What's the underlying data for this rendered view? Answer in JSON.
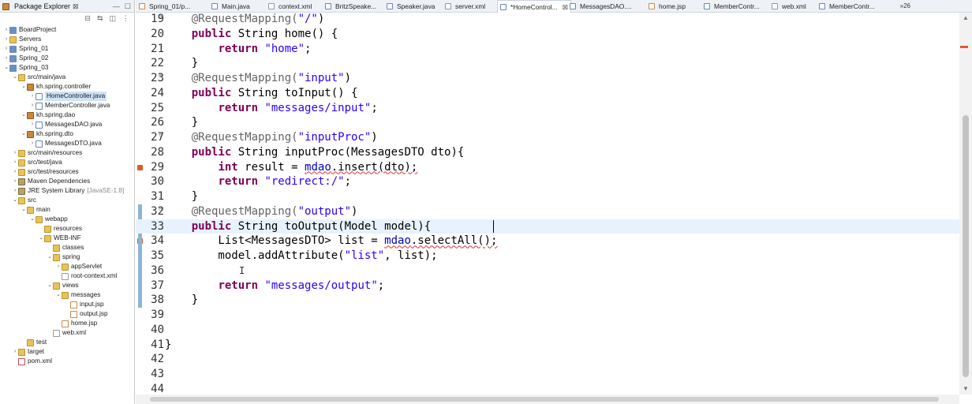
{
  "explorer": {
    "title": "Package Explorer",
    "close_glyph": "⊠",
    "tree": [
      {
        "label": "BoardProject",
        "arrow": "›",
        "icon": "project-icon",
        "indent": 0
      },
      {
        "label": "Servers",
        "arrow": "›",
        "icon": "folder-icon",
        "indent": 0
      },
      {
        "label": "Spring_01",
        "arrow": "›",
        "icon": "project-icon",
        "indent": 0
      },
      {
        "label": "Spring_02",
        "arrow": "›",
        "icon": "project-icon",
        "indent": 0
      },
      {
        "label": "Spring_03",
        "arrow": "⌄",
        "icon": "project-icon",
        "indent": 0
      },
      {
        "label": "src/main/java",
        "arrow": "⌄",
        "icon": "source-folder-icon",
        "indent": 1
      },
      {
        "label": "kh.spring.controller",
        "arrow": "⌄",
        "icon": "package-icon",
        "indent": 2
      },
      {
        "label": "HomeController.java",
        "arrow": "›",
        "icon": "java-file-icon",
        "indent": 3,
        "selected": true
      },
      {
        "label": "MemberController.java",
        "arrow": "›",
        "icon": "java-file-icon",
        "indent": 3
      },
      {
        "label": "kh.spring.dao",
        "arrow": "⌄",
        "icon": "package-icon",
        "indent": 2
      },
      {
        "label": "MessagesDAO.java",
        "arrow": "›",
        "icon": "java-file-icon",
        "indent": 3
      },
      {
        "label": "kh.spring.dto",
        "arrow": "⌄",
        "icon": "package-icon",
        "indent": 2
      },
      {
        "label": "MessagesDTO.java",
        "arrow": "›",
        "icon": "java-file-icon",
        "indent": 3
      },
      {
        "label": "src/main/resources",
        "arrow": "›",
        "icon": "source-folder-icon",
        "indent": 1
      },
      {
        "label": "src/test/java",
        "arrow": "›",
        "icon": "source-folder-icon",
        "indent": 1
      },
      {
        "label": "src/test/resources",
        "arrow": "›",
        "icon": "source-folder-icon",
        "indent": 1
      },
      {
        "label": "Maven Dependencies",
        "arrow": "›",
        "icon": "library-icon",
        "indent": 1
      },
      {
        "label": "JRE System Library",
        "extra": "[JavaSE-1.8]",
        "arrow": "›",
        "icon": "library-icon",
        "indent": 1
      },
      {
        "label": "src",
        "arrow": "⌄",
        "icon": "folder-icon",
        "indent": 1
      },
      {
        "label": "main",
        "arrow": "⌄",
        "icon": "folder-icon",
        "indent": 2
      },
      {
        "label": "webapp",
        "arrow": "⌄",
        "icon": "folder-icon",
        "indent": 3
      },
      {
        "label": "resources",
        "arrow": "",
        "icon": "folder-icon",
        "indent": 4
      },
      {
        "label": "WEB-INF",
        "arrow": "⌄",
        "icon": "folder-icon",
        "indent": 4
      },
      {
        "label": "classes",
        "arrow": "",
        "icon": "folder-icon",
        "indent": 5
      },
      {
        "label": "spring",
        "arrow": "⌄",
        "icon": "folder-icon",
        "indent": 5
      },
      {
        "label": "appServlet",
        "arrow": "›",
        "icon": "folder-icon",
        "indent": 6
      },
      {
        "label": "root-context.xml",
        "arrow": "",
        "icon": "xml-file-icon",
        "indent": 6
      },
      {
        "label": "views",
        "arrow": "⌄",
        "icon": "folder-icon",
        "indent": 5
      },
      {
        "label": "messages",
        "arrow": "⌄",
        "icon": "folder-icon",
        "indent": 6
      },
      {
        "label": "input.jsp",
        "arrow": "",
        "icon": "jsp-file-icon",
        "indent": 7
      },
      {
        "label": "output.jsp",
        "arrow": "",
        "icon": "jsp-file-icon",
        "indent": 7
      },
      {
        "label": "home.jsp",
        "arrow": "",
        "icon": "jsp-file-icon",
        "indent": 6
      },
      {
        "label": "web.xml",
        "arrow": "",
        "icon": "xml-file-icon",
        "indent": 5
      },
      {
        "label": "test",
        "arrow": "",
        "icon": "folder-icon",
        "indent": 2
      },
      {
        "label": "target",
        "arrow": "›",
        "icon": "folder-icon",
        "indent": 1
      },
      {
        "label": "pom.xml",
        "arrow": "",
        "icon": "pom-file-icon",
        "indent": 1
      }
    ]
  },
  "editor_tabs": [
    {
      "label": "Spring_01/p...",
      "icon": "jsp-file-icon"
    },
    {
      "label": "Main.java",
      "icon": "java-file-icon"
    },
    {
      "label": "context.xml",
      "icon": "xml-file-icon"
    },
    {
      "label": "BritzSpeake...",
      "icon": "java-file-icon"
    },
    {
      "label": "Speaker.java",
      "icon": "java-file-icon"
    },
    {
      "label": "server.xml",
      "icon": "xml-file-icon"
    },
    {
      "label": "*HomeControl...",
      "icon": "java-file-icon",
      "active": true,
      "close": "⊠"
    },
    {
      "label": "MessagesDAO....",
      "icon": "java-file-icon"
    },
    {
      "label": "home.jsp",
      "icon": "jsp-file-icon"
    },
    {
      "label": "MemberContr...",
      "icon": "java-file-icon"
    },
    {
      "label": "web.xml",
      "icon": "xml-file-icon"
    },
    {
      "label": "MemberContr...",
      "icon": "java-file-icon"
    }
  ],
  "overflow_tabs": "»26",
  "code_lines": [
    {
      "n": "19",
      "fold": "⊖",
      "tokens": [
        [
          "    ",
          ""
        ],
        [
          "@RequestMapping(",
          ""
        ],
        [
          "\"/\"",
          "str"
        ],
        [
          ")",
          ""
        ]
      ],
      "ann_prefix": true
    },
    {
      "n": "20",
      "tokens": [
        [
          "    ",
          ""
        ],
        [
          "public",
          "kw"
        ],
        [
          " String home() {",
          ""
        ]
      ]
    },
    {
      "n": "21",
      "tokens": [
        [
          "        ",
          ""
        ],
        [
          "return",
          "kw"
        ],
        [
          " ",
          ""
        ],
        [
          "\"home\"",
          "str"
        ],
        [
          ";",
          ""
        ]
      ]
    },
    {
      "n": "22",
      "tokens": [
        [
          "    }",
          ""
        ]
      ]
    },
    {
      "n": "23",
      "fold": "⊖",
      "tokens": [
        [
          "    ",
          ""
        ],
        [
          "@RequestMapping(",
          "ann"
        ],
        [
          "\"input\"",
          "str"
        ],
        [
          ")",
          ""
        ]
      ]
    },
    {
      "n": "24",
      "tokens": [
        [
          "    ",
          ""
        ],
        [
          "public",
          "kw"
        ],
        [
          " String toInput() {",
          ""
        ]
      ]
    },
    {
      "n": "25",
      "tokens": [
        [
          "        ",
          ""
        ],
        [
          "return",
          "kw"
        ],
        [
          " ",
          ""
        ],
        [
          "\"messages/input\"",
          "str"
        ],
        [
          ";",
          ""
        ]
      ]
    },
    {
      "n": "26",
      "tokens": [
        [
          "    }",
          ""
        ]
      ]
    },
    {
      "n": "27",
      "fold": "⊖",
      "tokens": [
        [
          "    ",
          ""
        ],
        [
          "@RequestMapping(",
          "ann"
        ],
        [
          "\"inputProc\"",
          "str"
        ],
        [
          ")",
          ""
        ]
      ]
    },
    {
      "n": "28",
      "tokens": [
        [
          "    ",
          ""
        ],
        [
          "public",
          "kw"
        ],
        [
          " String inputProc(MessagesDTO dto){",
          ""
        ]
      ]
    },
    {
      "n": "29",
      "marker": true,
      "tokens": [
        [
          "        ",
          ""
        ],
        [
          "int",
          "kw"
        ],
        [
          " result = ",
          ""
        ],
        [
          "mdao",
          "fld err"
        ],
        [
          ".insert(dto);",
          "err"
        ]
      ]
    },
    {
      "n": "30",
      "tokens": [
        [
          "        ",
          ""
        ],
        [
          "return",
          "kw"
        ],
        [
          " ",
          ""
        ],
        [
          "\"redirect:/\"",
          "str"
        ],
        [
          ";",
          ""
        ]
      ]
    },
    {
      "n": "31",
      "tokens": [
        [
          "    }",
          ""
        ]
      ]
    },
    {
      "n": "32",
      "fold": "⊖",
      "tokens": [
        [
          "    ",
          ""
        ],
        [
          "@RequestMapping(",
          "ann"
        ],
        [
          "\"output\"",
          "str"
        ],
        [
          ")",
          ""
        ]
      ]
    },
    {
      "n": "33",
      "current": true,
      "tokens": [
        [
          "    ",
          ""
        ],
        [
          "public",
          "kw"
        ],
        [
          " String toOutput(Model model){",
          ""
        ]
      ]
    },
    {
      "n": "34",
      "marker": true,
      "tokens": [
        [
          "        List<MessagesDTO> list = ",
          ""
        ],
        [
          "mdao",
          "fld err"
        ],
        [
          ".selectAll();",
          "err"
        ]
      ]
    },
    {
      "n": "35",
      "tokens": [
        [
          "        model.addAttribute(",
          ""
        ],
        [
          "\"list\"",
          "str"
        ],
        [
          ", list);",
          ""
        ]
      ]
    },
    {
      "n": "36",
      "tokens": [
        [
          "",
          ""
        ]
      ]
    },
    {
      "n": "37",
      "tokens": [
        [
          "        ",
          ""
        ],
        [
          "return",
          "kw"
        ],
        [
          " ",
          ""
        ],
        [
          "\"messages/output\"",
          "str"
        ],
        [
          ";",
          ""
        ]
      ]
    },
    {
      "n": "38",
      "tokens": [
        [
          "    }",
          ""
        ]
      ]
    },
    {
      "n": "39",
      "tokens": [
        [
          "",
          ""
        ]
      ]
    },
    {
      "n": "40",
      "tokens": [
        [
          "",
          ""
        ]
      ]
    },
    {
      "n": "41",
      "tokens": [
        [
          "}",
          ""
        ]
      ]
    },
    {
      "n": "42",
      "tokens": [
        [
          "",
          ""
        ]
      ]
    },
    {
      "n": "43",
      "tokens": [
        [
          "",
          ""
        ]
      ]
    },
    {
      "n": "44",
      "tokens": [
        [
          "",
          ""
        ]
      ]
    }
  ],
  "colors": {
    "keyword": "#7f0055",
    "string": "#2a00ff",
    "annotation": "#646464",
    "field": "#0000c0",
    "current_line": "#e8f2fe",
    "change_bar": "#8db4d6"
  }
}
